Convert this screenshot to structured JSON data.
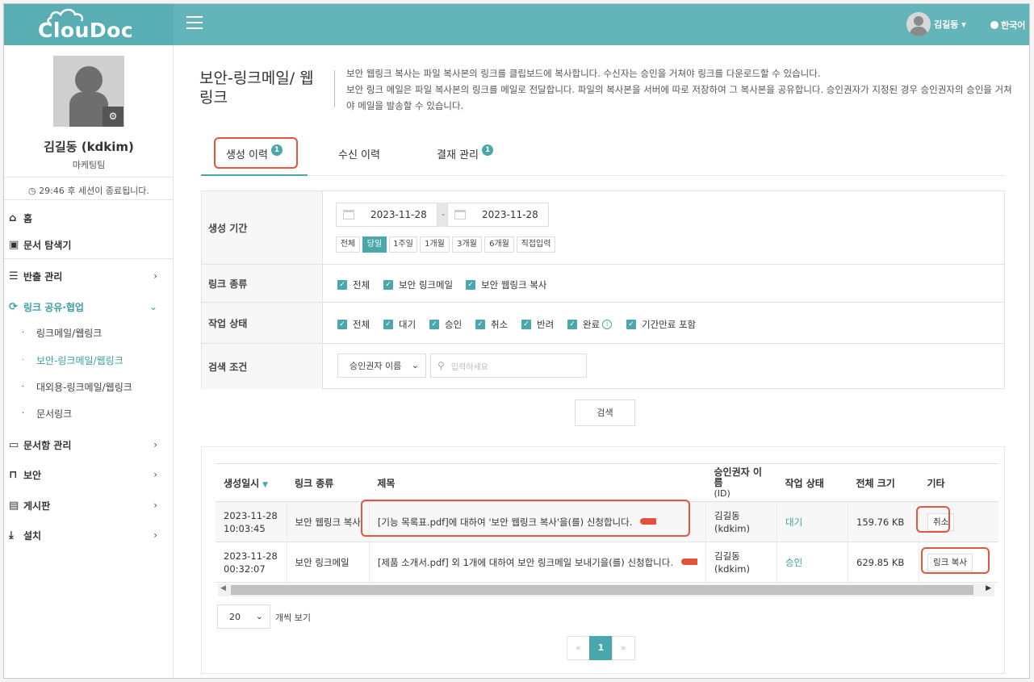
{
  "app": {
    "logo": "ClouDoc",
    "user_name": "김길동 ▾",
    "language": "한국어"
  },
  "sidebar": {
    "name": "김길동 (kdkim)",
    "dept": "마케팅팀",
    "session": "29:46 후 세션이 종료됩니다.",
    "nav": {
      "home": "홈",
      "explorer": "문서 탐색기",
      "export": "반출 관리",
      "link_share": "링크 공유·협업",
      "sub_linkmail": "링크메일/웹링크",
      "sub_secure": "보안-링크메일/웹링크",
      "sub_external": "대외용-링크메일/웹링크",
      "sub_doclink": "문서링크",
      "docbox": "문서함 관리",
      "security": "보안",
      "board": "게시판",
      "install": "설치"
    }
  },
  "page": {
    "title": "보안-링크메일/ 웹링크",
    "desc1": "보안 웹링크 복사는 파일 복사본의 링크를 클립보드에 복사합니다. 수신자는 승인을 거쳐야 링크를 다운로드할 수 있습니다.",
    "desc2": "보안 링크 메일은 파일 복사본의 링크를 메일로 전달합니다. 파일의 복사본을 서버에 따로 저장하여 그 복사본을 공유합니다. 승인권자가 지정된 경우 승인권자의 승인을 거쳐야 메일을 발송할 수 있습니다."
  },
  "tabs": [
    {
      "label": "생성 이력",
      "badge": "1"
    },
    {
      "label": "수신 이력",
      "badge": ""
    },
    {
      "label": "결재 관리",
      "badge": "1"
    }
  ],
  "filter": {
    "period_label": "생성 기간",
    "date_from": "2023-11-28",
    "date_to": "2023-11-28",
    "date_sep": "-",
    "quick": [
      "전체",
      "당일",
      "1주일",
      "1개월",
      "3개월",
      "6개월",
      "직접입력"
    ],
    "link_type_label": "링크 종류",
    "link_types": [
      "전체",
      "보안 링크메일",
      "보안 웹링크 복사"
    ],
    "status_label": "작업 상태",
    "statuses": [
      "전체",
      "대기",
      "승인",
      "취소",
      "반려",
      "완료",
      "기간만료 포함"
    ],
    "search_label": "검색 조건",
    "search_field": "승인권자 이름",
    "search_placeholder": "입력하세요",
    "search_button": "검색"
  },
  "table": {
    "headers": [
      "생성일시",
      "링크 종류",
      "제목",
      "승인권자 이름",
      "(ID)",
      "작업 상태",
      "전체 크기",
      "기타"
    ],
    "rows": [
      {
        "date": "2023-11-28",
        "time": "10:03:45",
        "type": "보안 웹링크 복사",
        "title": "[기능 목록표.pdf]에 대하여 '보안 웹링크 복사'을(를) 신청합니다.",
        "approver": "김길동",
        "approver_id": "(kdkim)",
        "status": "대기",
        "size": "159.76 KB",
        "action": "취소"
      },
      {
        "date": "2023-11-28",
        "time": "00:32:07",
        "type": "보안 링크메일",
        "title": "[제품 소개서.pdf] 외 1개에 대하여 보안 링크메일 보내기을(를) 신청합니다.",
        "approver": "김길동",
        "approver_id": "(kdkim)",
        "status": "승인",
        "size": "629.85 KB",
        "action": "링크 복사"
      }
    ]
  },
  "pagination": {
    "page_size": "20",
    "per_label": "개씩 보기",
    "prev": "«",
    "current": "1",
    "next": "»"
  }
}
